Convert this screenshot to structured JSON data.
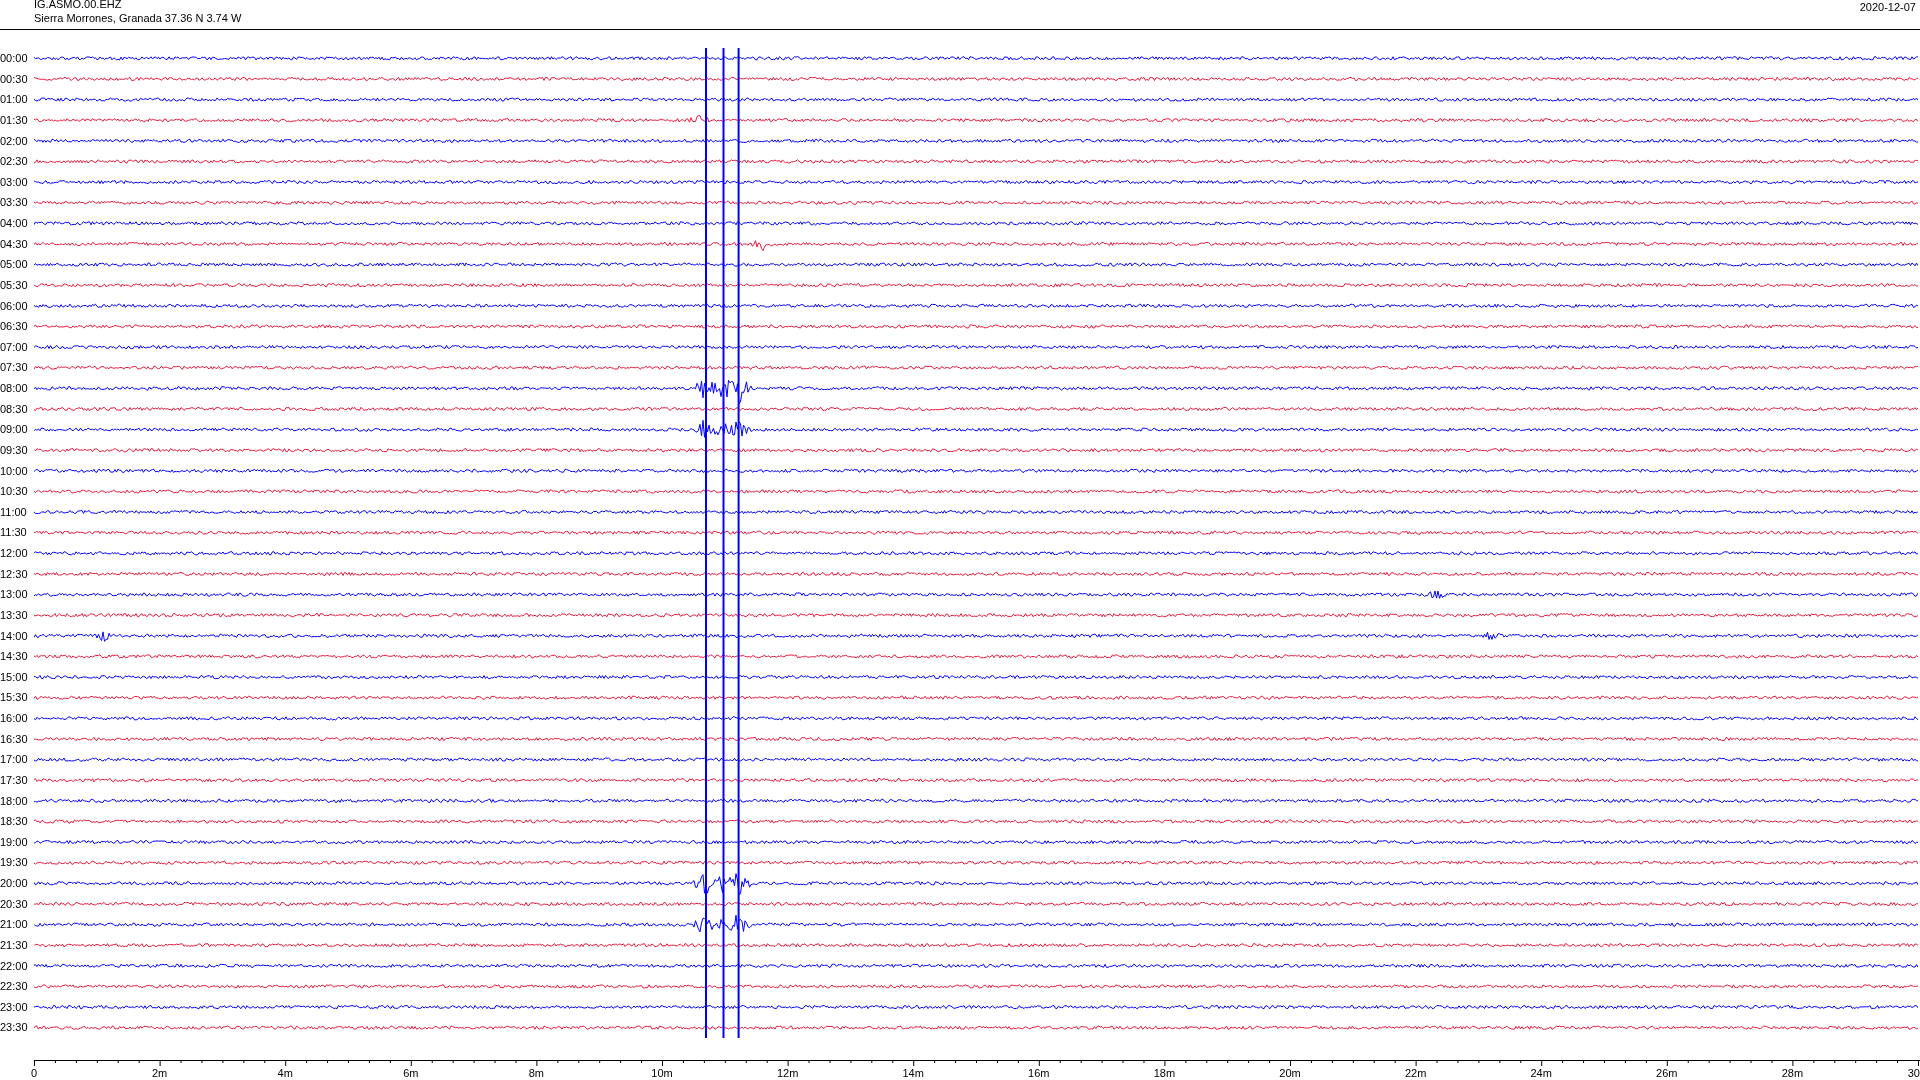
{
  "header": {
    "station": "IG.ASMO.00.EHZ",
    "location": "Sierra Morrones, Granada  37.36 N 3.74 W",
    "date": "2020-12-07"
  },
  "rows": [
    {
      "time": "00:00",
      "color": "#0000ff"
    },
    {
      "time": "00:30",
      "color": "#e8173c"
    },
    {
      "time": "01:00",
      "color": "#0000ff"
    },
    {
      "time": "01:30",
      "color": "#e8173c"
    },
    {
      "time": "02:00",
      "color": "#0000ff"
    },
    {
      "time": "02:30",
      "color": "#e8173c"
    },
    {
      "time": "03:00",
      "color": "#0000ff"
    },
    {
      "time": "03:30",
      "color": "#e8173c"
    },
    {
      "time": "04:00",
      "color": "#0000ff"
    },
    {
      "time": "04:30",
      "color": "#e8173c"
    },
    {
      "time": "05:00",
      "color": "#0000ff"
    },
    {
      "time": "05:30",
      "color": "#e8173c"
    },
    {
      "time": "06:00",
      "color": "#0000ff"
    },
    {
      "time": "06:30",
      "color": "#e8173c"
    },
    {
      "time": "07:00",
      "color": "#0000ff"
    },
    {
      "time": "07:30",
      "color": "#e8173c"
    },
    {
      "time": "08:00",
      "color": "#0000ff"
    },
    {
      "time": "08:30",
      "color": "#e8173c"
    },
    {
      "time": "09:00",
      "color": "#0000ff"
    },
    {
      "time": "09:30",
      "color": "#e8173c"
    },
    {
      "time": "10:00",
      "color": "#0000ff"
    },
    {
      "time": "10:30",
      "color": "#e8173c"
    },
    {
      "time": "11:00",
      "color": "#0000ff"
    },
    {
      "time": "11:30",
      "color": "#e8173c"
    },
    {
      "time": "12:00",
      "color": "#0000ff"
    },
    {
      "time": "12:30",
      "color": "#e8173c"
    },
    {
      "time": "13:00",
      "color": "#0000ff"
    },
    {
      "time": "13:30",
      "color": "#e8173c"
    },
    {
      "time": "14:00",
      "color": "#0000ff"
    },
    {
      "time": "14:30",
      "color": "#e8173c"
    },
    {
      "time": "15:00",
      "color": "#0000ff"
    },
    {
      "time": "15:30",
      "color": "#e8173c"
    },
    {
      "time": "16:00",
      "color": "#0000ff"
    },
    {
      "time": "16:30",
      "color": "#e8173c"
    },
    {
      "time": "17:00",
      "color": "#0000ff"
    },
    {
      "time": "17:30",
      "color": "#e8173c"
    },
    {
      "time": "18:00",
      "color": "#0000ff"
    },
    {
      "time": "18:30",
      "color": "#e8173c"
    },
    {
      "time": "19:00",
      "color": "#0000ff"
    },
    {
      "time": "19:30",
      "color": "#e8173c"
    },
    {
      "time": "20:00",
      "color": "#0000ff"
    },
    {
      "time": "20:30",
      "color": "#e8173c"
    },
    {
      "time": "21:00",
      "color": "#0000ff"
    },
    {
      "time": "21:30",
      "color": "#e8173c"
    },
    {
      "time": "22:00",
      "color": "#0000ff"
    },
    {
      "time": "22:30",
      "color": "#e8173c"
    },
    {
      "time": "23:00",
      "color": "#0000ff"
    },
    {
      "time": "23:30",
      "color": "#e8173c"
    }
  ],
  "axis": {
    "labels": [
      "0",
      "2m",
      "4m",
      "6m",
      "8m",
      "10m",
      "12m",
      "14m",
      "16m",
      "18m",
      "20m",
      "22m",
      "24m",
      "26m",
      "28m",
      "30"
    ]
  }
}
